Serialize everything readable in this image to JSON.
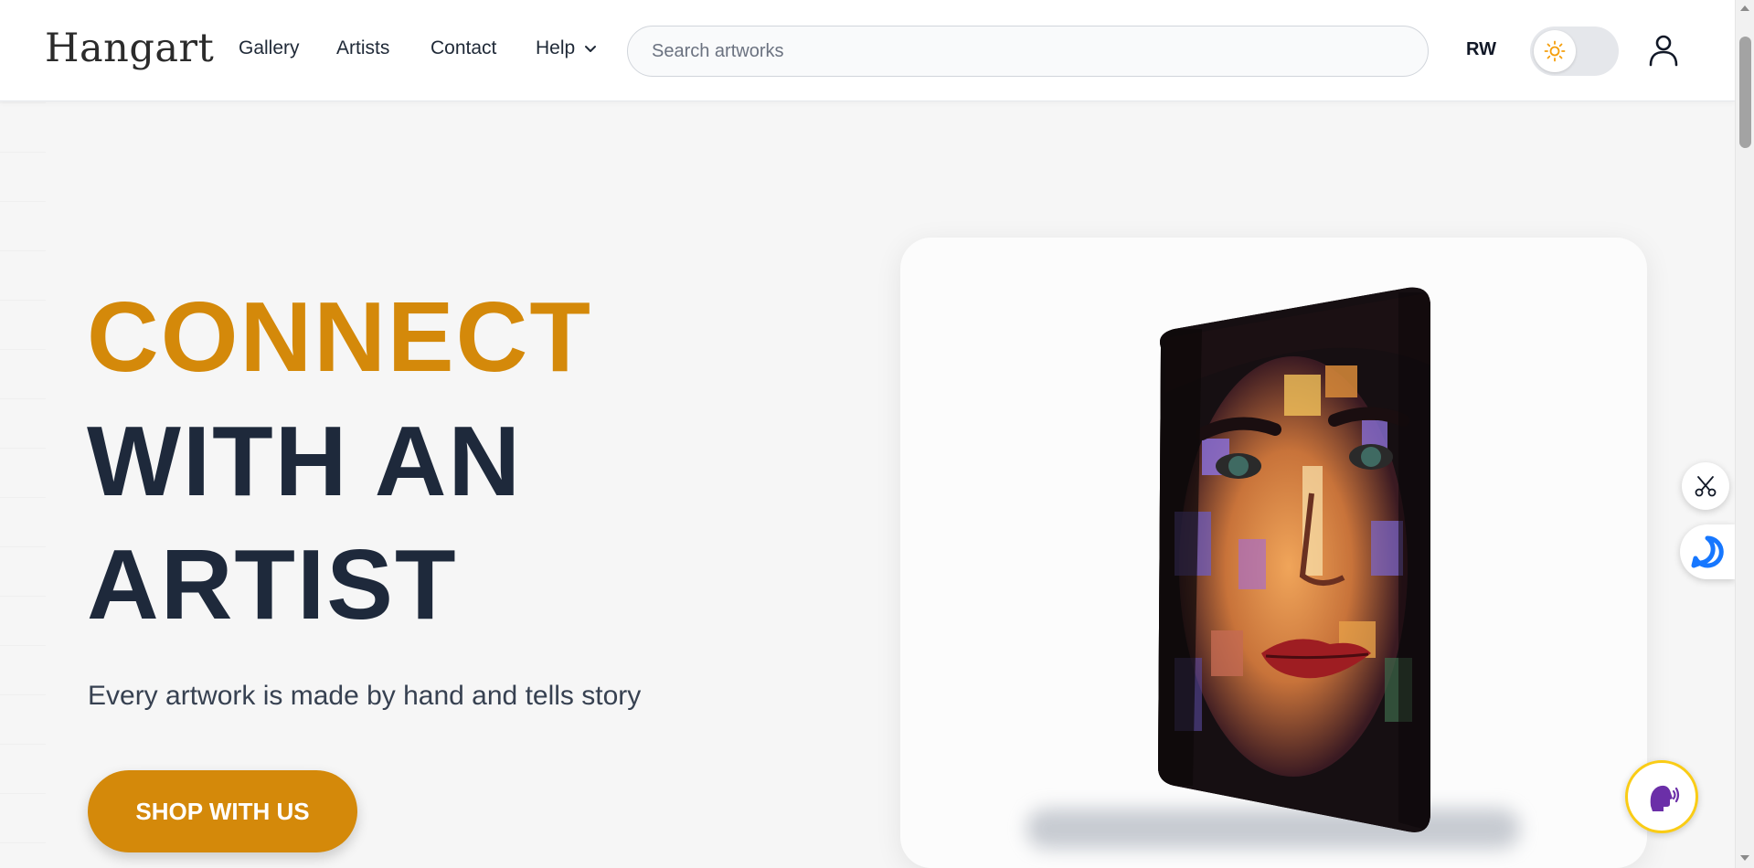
{
  "header": {
    "logo": "Hangart",
    "nav": [
      {
        "label": "Gallery"
      },
      {
        "label": "Artists"
      },
      {
        "label": "Contact"
      },
      {
        "label": "Help"
      }
    ],
    "search": {
      "placeholder": "Search artworks",
      "value": ""
    },
    "language": "RW",
    "theme_toggle": {
      "state": "light"
    }
  },
  "hero": {
    "title_lines": [
      "CONNECT",
      "WITH AN",
      "ARTIST"
    ],
    "tagline": "Every artwork is made by hand and tells story",
    "cta_label": "SHOP WITH US"
  },
  "artwork": {
    "description": "painted portrait of a woman's face"
  },
  "colors": {
    "accent": "#d4890a",
    "heading": "#1e293b",
    "background": "#f6f6f6"
  },
  "floating_widgets": [
    {
      "icon": "scissors-icon"
    },
    {
      "icon": "chat-bubble-icon"
    },
    {
      "icon": "voice-assistant-icon"
    }
  ]
}
